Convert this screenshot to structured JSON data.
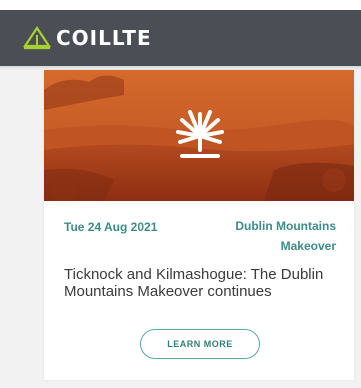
{
  "header": {
    "brand_name": "COILLTE",
    "logo_icon": "tree-triangle-icon",
    "background": "#4b4f55"
  },
  "card": {
    "hero_icon": "coillte-tree-mark-icon",
    "date": "Tue 24 Aug 2021",
    "category": "Dublin Mountains Makeover",
    "title": "Ticknock and Kilmashogue: The Dublin Mountains Makeover continues",
    "button_label": "LEARN MORE"
  },
  "colors": {
    "accent": "#3d8c8a",
    "brand_green": "#9acd32",
    "hero_orange": "#c8622a"
  }
}
